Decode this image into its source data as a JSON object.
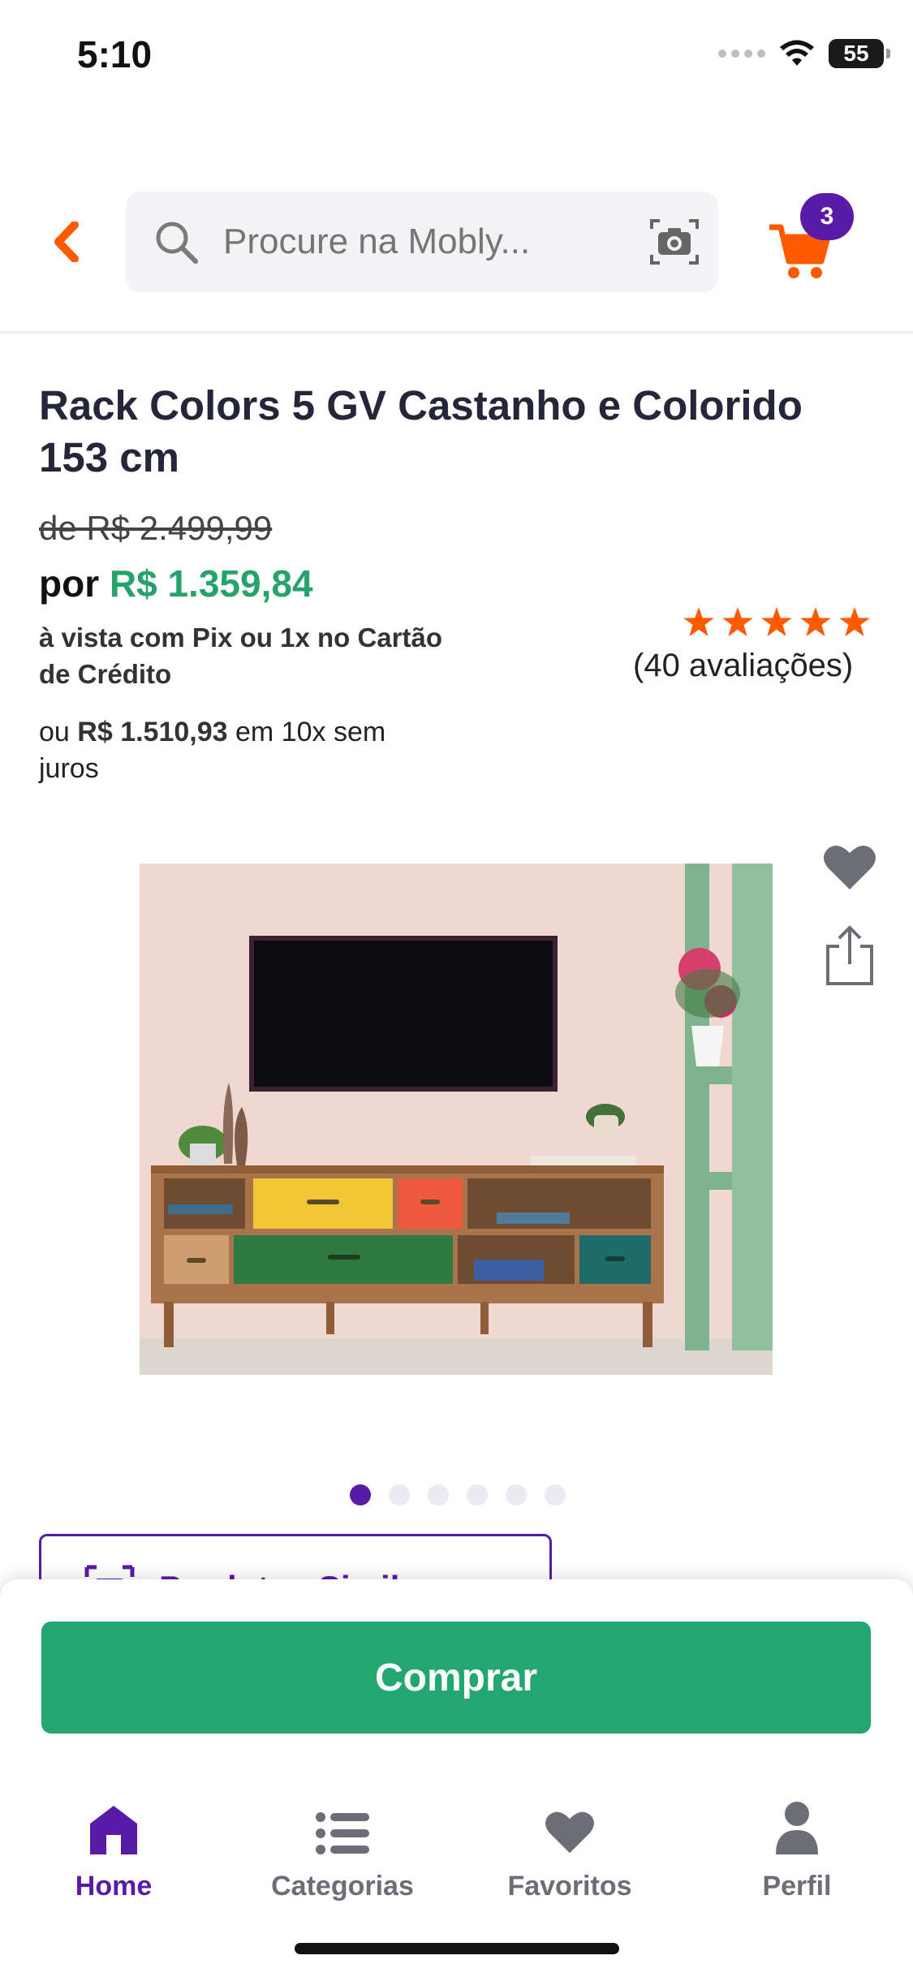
{
  "status_bar": {
    "time": "5:10",
    "battery": "55"
  },
  "header": {
    "search_placeholder": "Procure na Mobly...",
    "cart_count": "3"
  },
  "product": {
    "title": "Rack Colors 5 GV Castanho e Colorido 153 cm",
    "old_price": "de R$ 2.499,99",
    "price_prefix": "por",
    "price": "R$ 1.359,84",
    "pix_note": "à vista com Pix ou 1x no Cartão de Crédito",
    "install_prefix": "ou",
    "install_value": "R$ 1.510,93",
    "install_suffix": "em 10x sem juros",
    "rating": 5,
    "reviews": "(40 avaliações)"
  },
  "carousel": {
    "count": 6,
    "active_index": 0
  },
  "similar": {
    "label": "Produtos Similares"
  },
  "buy": {
    "label": "Comprar"
  },
  "tabs": [
    {
      "label": "Home",
      "icon": "home-icon",
      "active": true
    },
    {
      "label": "Categorias",
      "icon": "list-icon",
      "active": false
    },
    {
      "label": "Favoritos",
      "icon": "heart-icon",
      "active": false
    },
    {
      "label": "Perfil",
      "icon": "person-icon",
      "active": false
    }
  ],
  "colors": {
    "brand_purple": "#5a1aa8",
    "accent_orange": "#ff5a00",
    "price_green": "#26a36b",
    "buy_green": "#22a86f"
  }
}
